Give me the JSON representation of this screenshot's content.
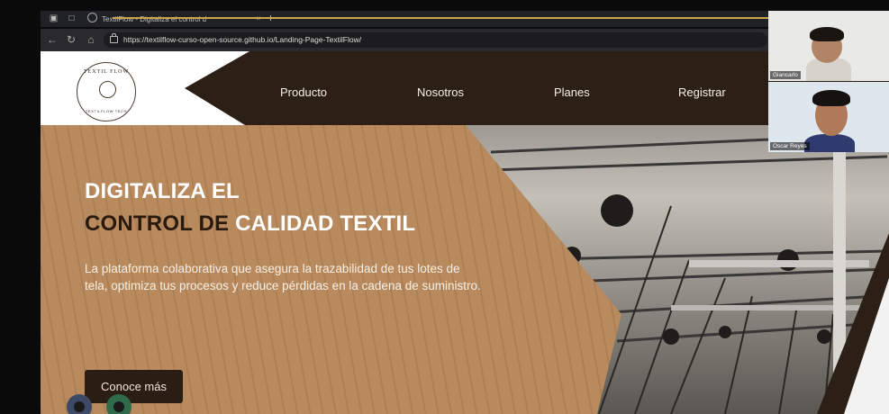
{
  "browser": {
    "tab_title": "TextilFlow - Digitaliza el control d",
    "url": "https://textilflow-curso-open-source.github.io/Landing-Page-TextilFlow/"
  },
  "logo": {
    "top_text": "TEXTIL FLOW",
    "bottom_text": "TEXTILFLOW TECH"
  },
  "nav": {
    "items": [
      {
        "label": "Producto"
      },
      {
        "label": "Nosotros"
      },
      {
        "label": "Planes"
      },
      {
        "label": "Registrar"
      }
    ]
  },
  "hero": {
    "title_line1": "DIGITALIZA EL",
    "title_line2_dark": "CONTROL DE ",
    "title_line2_light": "CALIDAD TEXTIL",
    "description": "La plataforma colaborativa que asegura la trazabilidad de tus lotes de tela, optimiza tus procesos y reduce pérdidas en la cadena de suministro.",
    "cta_label": "Conoce más"
  },
  "call": {
    "participants": [
      {
        "name": "Giancarlo"
      },
      {
        "name": "Oscar Reyes"
      }
    ]
  },
  "colors": {
    "accent_brown": "#b88a5d",
    "dark_brown": "#2b1f16"
  }
}
